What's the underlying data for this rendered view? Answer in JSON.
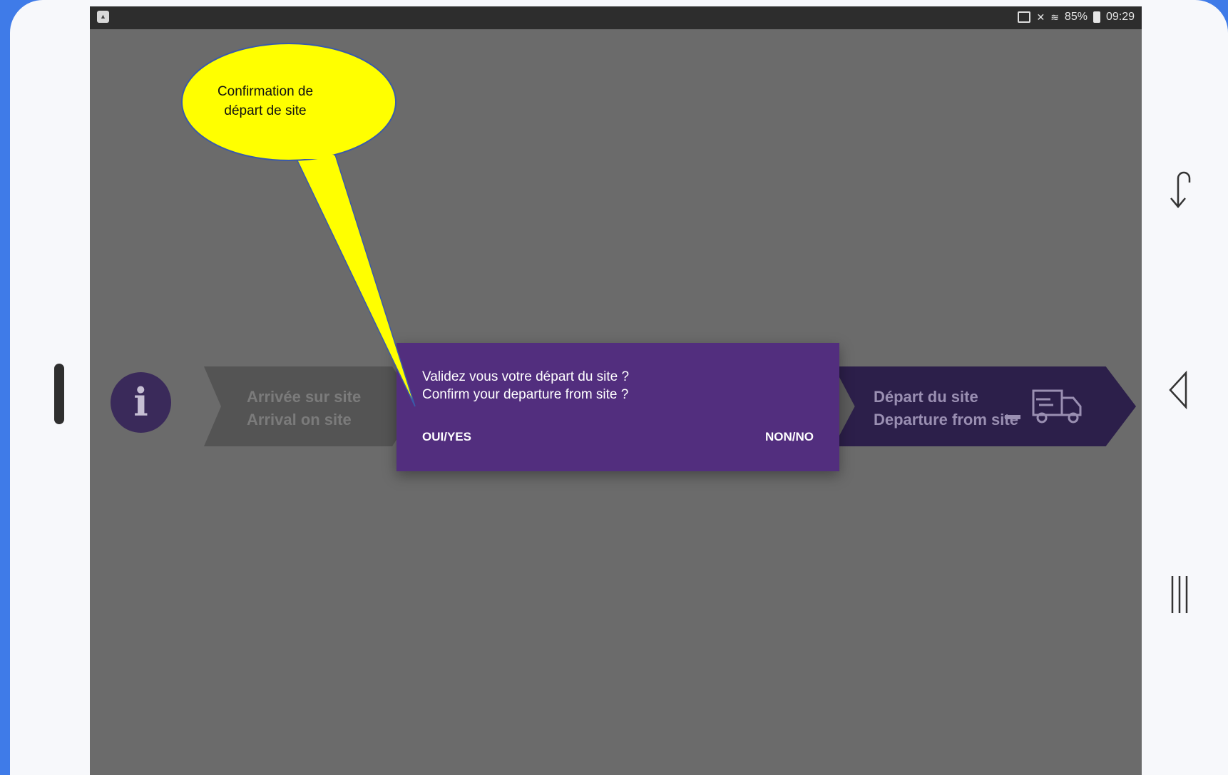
{
  "status_bar": {
    "battery_text": "85%",
    "time": "09:29",
    "icons": [
      "gallery-icon",
      "cast-icon",
      "mute-icon",
      "wifi-icon",
      "battery-icon"
    ]
  },
  "workflow": {
    "arrival": {
      "line1": "Arrivée sur site",
      "line2": "Arrival on site"
    },
    "departure": {
      "line1": "Départ du site",
      "line2": "Departure from site"
    },
    "info_icon": "info-icon",
    "departure_icon": "truck-icon"
  },
  "dialog": {
    "message_fr": "Validez vous votre départ du site ?",
    "message_en": "Confirm your departure from site ?",
    "yes_label": "OUI/YES",
    "no_label": "NON/NO"
  },
  "callout": {
    "line1": "Confirmation de",
    "line2": "départ de site"
  },
  "nav_bar": {
    "icons": [
      "back-icon",
      "home-icon",
      "recent-apps-icon"
    ]
  },
  "colors": {
    "dialog_bg": "#522e7e",
    "callout_fill": "#ffff00",
    "frame_blue": "#3f7be8",
    "screen_dim": "#6b6b6b"
  }
}
